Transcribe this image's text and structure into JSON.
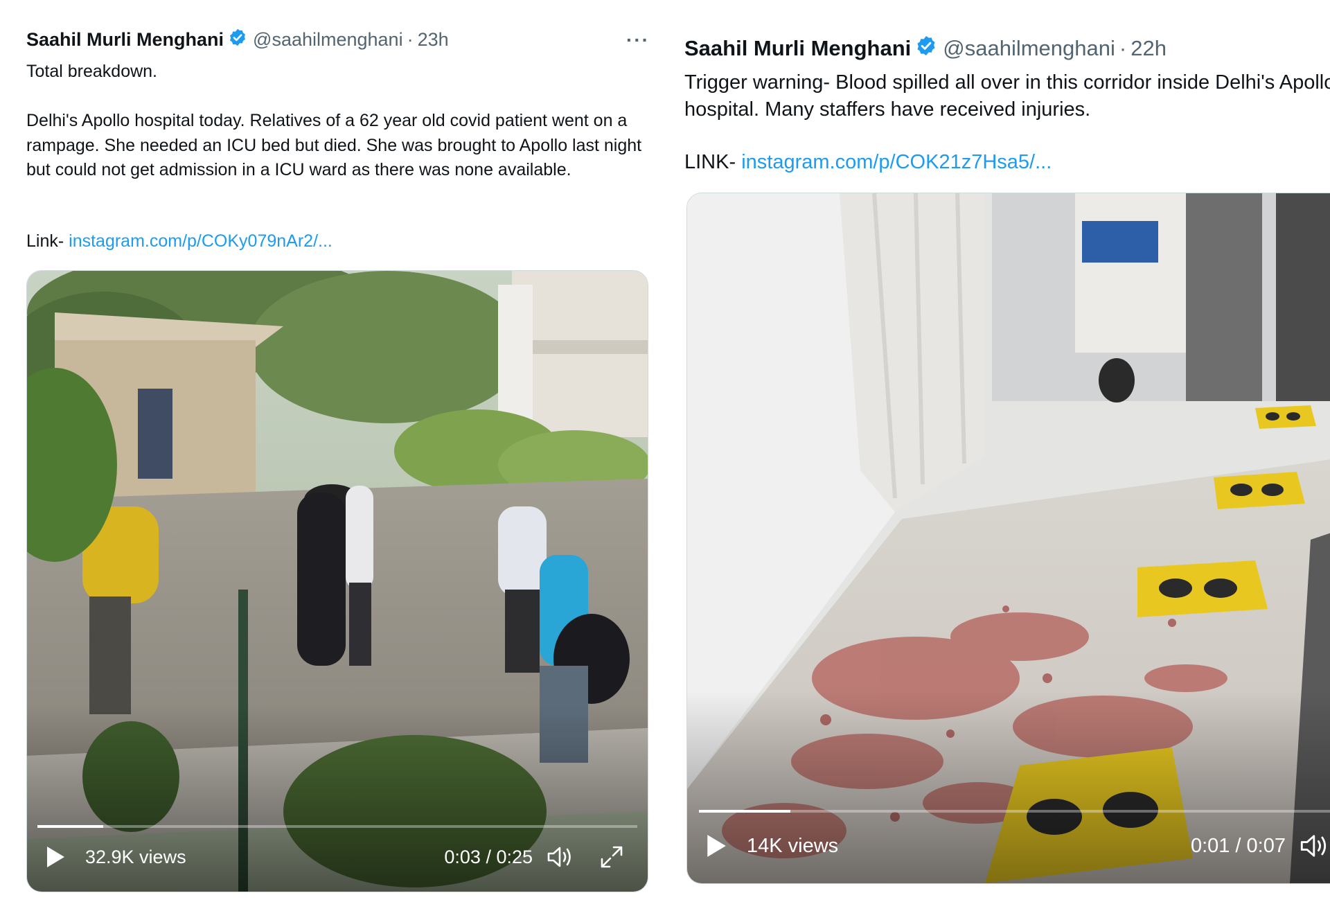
{
  "tweet_left": {
    "author_name": "Saahil Murli Menghani",
    "handle": "@saahilmenghani",
    "separator": "·",
    "time": "23h",
    "more_label": "···",
    "text": "Total breakdown.\n\nDelhi's Apollo hospital today. Relatives of a 62 year old covid patient went on a rampage. She needed an ICU bed but died. She was brought to Apollo last night but could not get admission in a ICU ward as there was none available.",
    "link_prefix": "Link- ",
    "link_text": "instagram.com/p/COKy079nAr2/...",
    "video": {
      "views": "32.9K views",
      "timecode": "0:03 / 0:25",
      "progress": 0.11
    }
  },
  "tweet_right": {
    "author_name": "Saahil Murli Menghani",
    "handle": "@saahilmenghani",
    "separator": "·",
    "time": "22h",
    "text": "Trigger warning- Blood spilled all over in this corridor inside Delhi's Apollo\nhospital. Many staffers have received injuries.",
    "link_prefix": "LINK- ",
    "link_text": "instagram.com/p/COK21z7Hsa5/...",
    "video": {
      "views": "14K views",
      "timecode": "0:01 / 0:07",
      "progress": 0.14
    }
  },
  "colors": {
    "verified_blue": "#1d9bf0",
    "link_blue": "#1d9bf0",
    "secondary_text": "#536471"
  }
}
